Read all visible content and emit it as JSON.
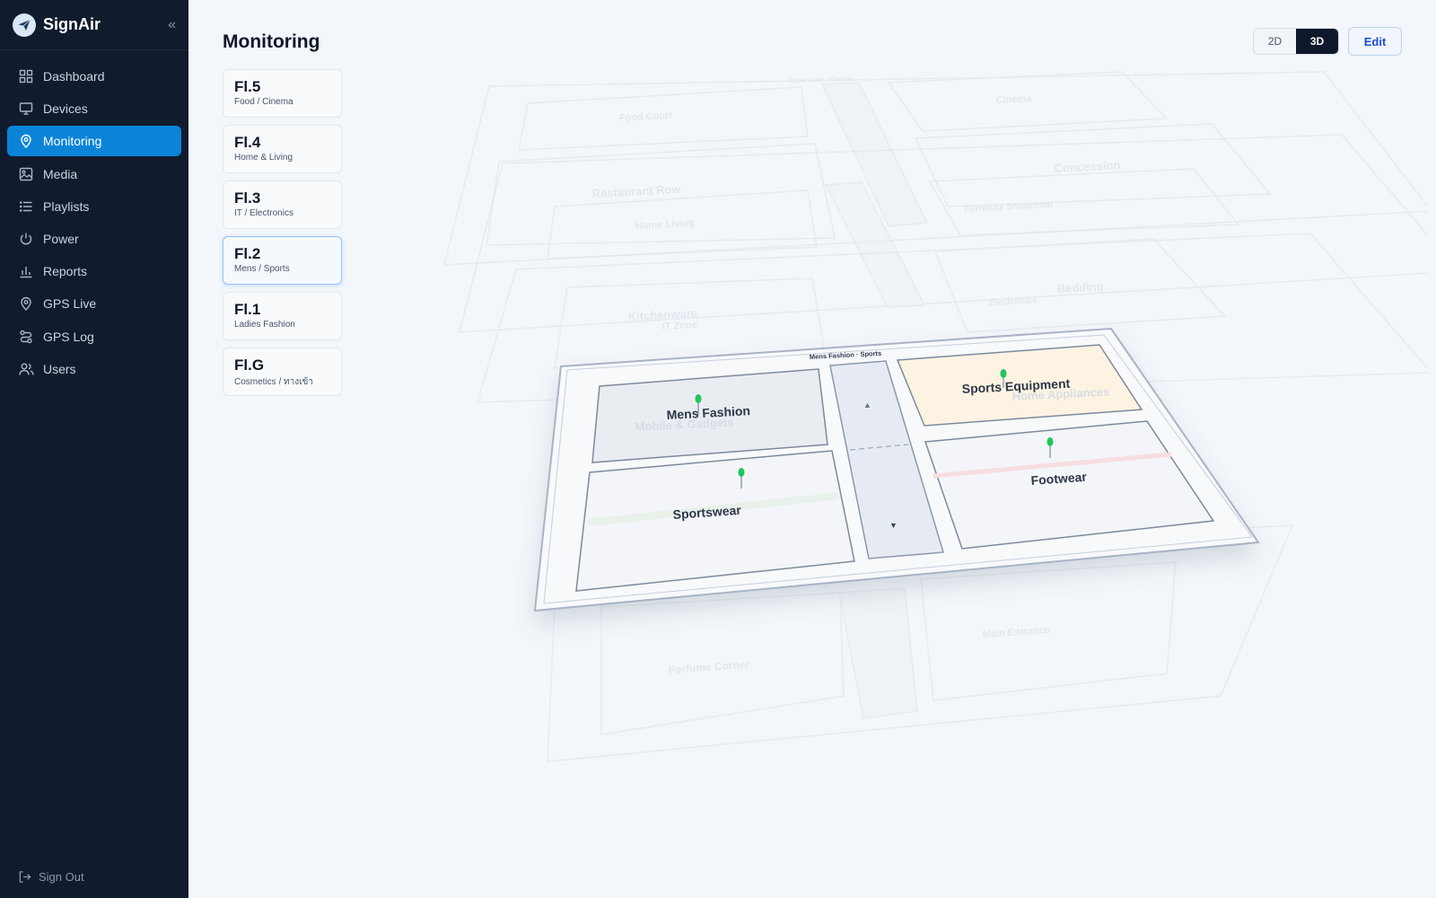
{
  "app": {
    "name": "SignAir"
  },
  "sidebar": {
    "items": [
      {
        "label": "Dashboard",
        "icon": "grid-icon"
      },
      {
        "label": "Devices",
        "icon": "monitor-icon"
      },
      {
        "label": "Monitoring",
        "icon": "map-pin-icon",
        "active": true
      },
      {
        "label": "Media",
        "icon": "image-icon"
      },
      {
        "label": "Playlists",
        "icon": "list-icon"
      },
      {
        "label": "Power",
        "icon": "power-icon"
      },
      {
        "label": "Reports",
        "icon": "bar-chart-icon"
      },
      {
        "label": "GPS Live",
        "icon": "map-pin-icon"
      },
      {
        "label": "GPS Log",
        "icon": "route-icon"
      },
      {
        "label": "Users",
        "icon": "users-icon"
      }
    ],
    "sign_out": "Sign Out"
  },
  "page": {
    "title": "Monitoring"
  },
  "floors": [
    {
      "code": "Fl.5",
      "name": "Food / Cinema"
    },
    {
      "code": "Fl.4",
      "name": "Home & Living"
    },
    {
      "code": "Fl.3",
      "name": "IT / Electronics"
    },
    {
      "code": "Fl.2",
      "name": "Mens / Sports",
      "active": true
    },
    {
      "code": "Fl.1",
      "name": "Ladies Fashion"
    },
    {
      "code": "Fl.G",
      "name": "Cosmetics / ทางเข้า"
    }
  ],
  "view_toggle": {
    "options": [
      "2D",
      "3D"
    ],
    "selected": "3D"
  },
  "edit_label": "Edit",
  "map": {
    "active_floor_title": "Mens Fashion · Sports",
    "active_zones": {
      "mens_fashion": "Mens Fashion",
      "sports_equipment": "Sports Equipment",
      "sportswear": "Sportswear",
      "footwear": "Footwear"
    },
    "background_zones": {
      "food_court_cinema": "Food Court · Cinema",
      "food_court": "Food Court",
      "cinema": "Cinema",
      "restaurant_row": "Restaurant Row",
      "concession": "Concession",
      "home_living": "Home Living",
      "furniture_showroom": "Furniture Showroom",
      "kitchenware": "Kitchenware",
      "it_zone": "IT Zone",
      "bedding": "Bedding",
      "electronics": "Electronics",
      "mobile_gadgets": "Mobile & Gadgets",
      "home_appliances": "Home Appliances",
      "perfume_corner": "Perfume Corner",
      "main_entrance": "Main Entrance"
    },
    "colors": {
      "device_pin": "#22c55e",
      "highlight_zone": "#fdf3e3",
      "accent": "#0b84d8"
    }
  }
}
